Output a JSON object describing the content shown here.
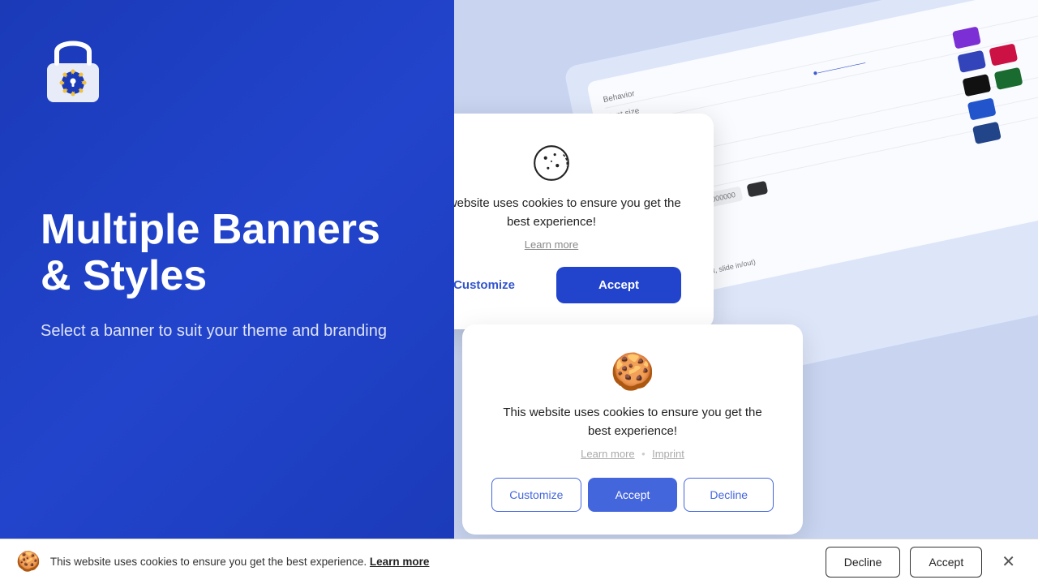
{
  "left": {
    "title": "Multiple Banners & Styles",
    "subtitle": "Select a banner to suit your theme and branding"
  },
  "banner1": {
    "message": "This website uses cookies to ensure you get the best experience!",
    "learn_more": "Learn more",
    "customize_label": "Customize",
    "accept_label": "Accept"
  },
  "banner2": {
    "message": "This website uses cookies to ensure you get the best experience!",
    "learn_more": "Learn more",
    "dot": "•",
    "imprint": "Imprint",
    "customize_label": "Customize",
    "accept_label": "Accept",
    "decline_label": "Decline"
  },
  "bottom_bar": {
    "message": "This website uses cookies to ensure you get the best experience.",
    "learn_more": "Learn more",
    "decline_label": "Decline",
    "accept_label": "Accept"
  },
  "swatches": [
    {
      "color": "#7b2fd4"
    },
    {
      "color": "#3344bb"
    },
    {
      "color": "#111111"
    },
    {
      "color": "#1a6b2f"
    },
    {
      "color": "#cc2244"
    },
    {
      "color": "#2255cc"
    },
    {
      "color": "#224488"
    }
  ]
}
